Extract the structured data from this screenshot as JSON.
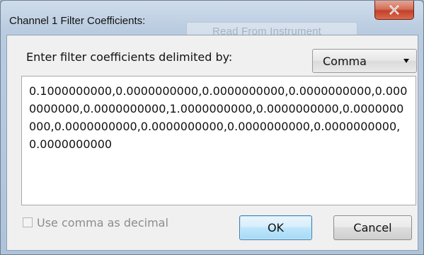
{
  "window": {
    "title": "Channel 1 Filter Coefficients:",
    "background_button_label": "Read From Instrument",
    "close_icon": "close-icon"
  },
  "prompt": {
    "label": "Enter filter coefficients delimited by:"
  },
  "delimiter": {
    "selected": "Comma",
    "icon": "chevron-down-icon"
  },
  "coefficients": {
    "text": "0.1000000000,0.0000000000,0.0000000000,0.0000000000,0.0000000000,0.0000000000,1.0000000000,0.0000000000,0.0000000000,0.0000000000,0.0000000000,0.0000000000,0.0000000000,0.0000000000"
  },
  "options": {
    "use_comma_label": "Use comma as decimal",
    "use_comma_checked": false,
    "use_comma_enabled": false
  },
  "buttons": {
    "ok_label": "OK",
    "cancel_label": "Cancel"
  },
  "colors": {
    "close_button": "#c7422d",
    "ok_button": "#bee6fd",
    "window_frame": "#b9cbe0"
  }
}
